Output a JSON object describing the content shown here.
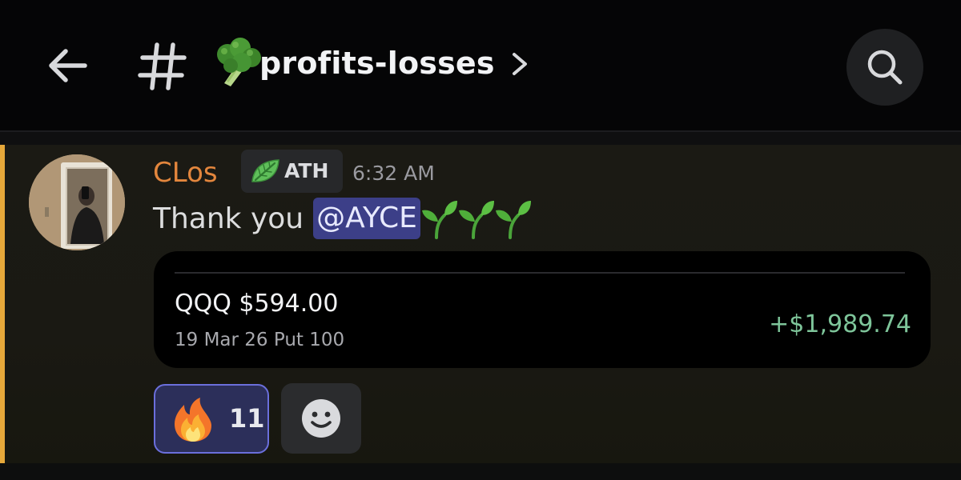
{
  "header": {
    "back_icon": "arrow-left-icon",
    "channel_hash_icon": "hash-icon",
    "channel_emoji": "broccoli-icon",
    "channel_name": "profits-losses",
    "channel_chevron_icon": "chevron-right-icon",
    "search_icon": "search-icon"
  },
  "message": {
    "author": "CLos",
    "author_color": "#e3863d",
    "role": {
      "icon": "leaf-icon",
      "label": "ATH"
    },
    "timestamp": "6:32 AM",
    "text_prefix": "Thank you",
    "mention": "@AYCE",
    "emoji_suffix": [
      "sprout-icon",
      "sprout-icon",
      "sprout-icon"
    ],
    "highlight_color": "#e6a83a",
    "trade_card": {
      "title": "QQQ $594.00",
      "subtitle": "19 Mar 26 Put 100",
      "pnl": "+$1,989.74",
      "pnl_color": "#7ec59a"
    },
    "reactions": [
      {
        "emoji": "fire-icon",
        "count": "11",
        "selected": true
      }
    ],
    "add_reaction_icon": "smiley-icon"
  }
}
